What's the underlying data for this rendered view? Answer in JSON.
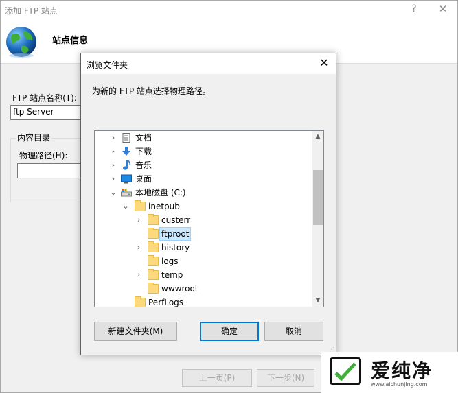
{
  "parent_window": {
    "title": "添加 FTP 站点",
    "help_glyph": "?",
    "close_glyph": "✕",
    "heading": "站点信息",
    "site_name_label": "FTP 站点名称(T):",
    "site_name_value": "ftp Server",
    "content_group_label": "内容目录",
    "physical_path_label": "物理路径(H):",
    "physical_path_value": "",
    "prev_button": "上一页(P)",
    "next_button": "下一步(N)"
  },
  "dialog": {
    "title": "浏览文件夹",
    "close_glyph": "✕",
    "instruction": "为新的 FTP 站点选择物理路径。",
    "tree": [
      {
        "label": "文档",
        "icon": "documents-icon",
        "expander": "›",
        "expanded": false
      },
      {
        "label": "下载",
        "icon": "downloads-icon",
        "expander": "›",
        "expanded": false
      },
      {
        "label": "音乐",
        "icon": "music-icon",
        "expander": "›",
        "expanded": false
      },
      {
        "label": "桌面",
        "icon": "desktop-icon",
        "expander": "›",
        "expanded": false
      },
      {
        "label": "本地磁盘 (C:)",
        "icon": "local-disk-icon",
        "expander": "⌄",
        "expanded": true
      },
      {
        "label": "inetpub",
        "icon": "folder-icon",
        "expander": "⌄",
        "expanded": true
      },
      {
        "label": "custerr",
        "icon": "folder-icon",
        "expander": "›",
        "expanded": false
      },
      {
        "label": "ftproot",
        "icon": "folder-icon",
        "expander": "",
        "selected": true
      },
      {
        "label": "history",
        "icon": "folder-icon",
        "expander": "›",
        "expanded": false
      },
      {
        "label": "logs",
        "icon": "folder-icon",
        "expander": ""
      },
      {
        "label": "temp",
        "icon": "folder-icon",
        "expander": "›",
        "expanded": false
      },
      {
        "label": "wwwroot",
        "icon": "folder-icon",
        "expander": ""
      },
      {
        "label": "PerfLogs",
        "icon": "folder-icon",
        "expander": ""
      }
    ],
    "scroll_up_glyph": "▲",
    "scroll_down_glyph": "▼",
    "new_folder_button": "新建文件夹(M)",
    "ok_button": "确定",
    "cancel_button": "取消"
  },
  "watermark": {
    "text": "爱纯净",
    "url": "www.aichunjing.com"
  },
  "colors": {
    "selection_fill": "#cce8ff",
    "selection_border": "#99d1ff",
    "accent": "#0078d7",
    "folder": "#fcd97c"
  }
}
